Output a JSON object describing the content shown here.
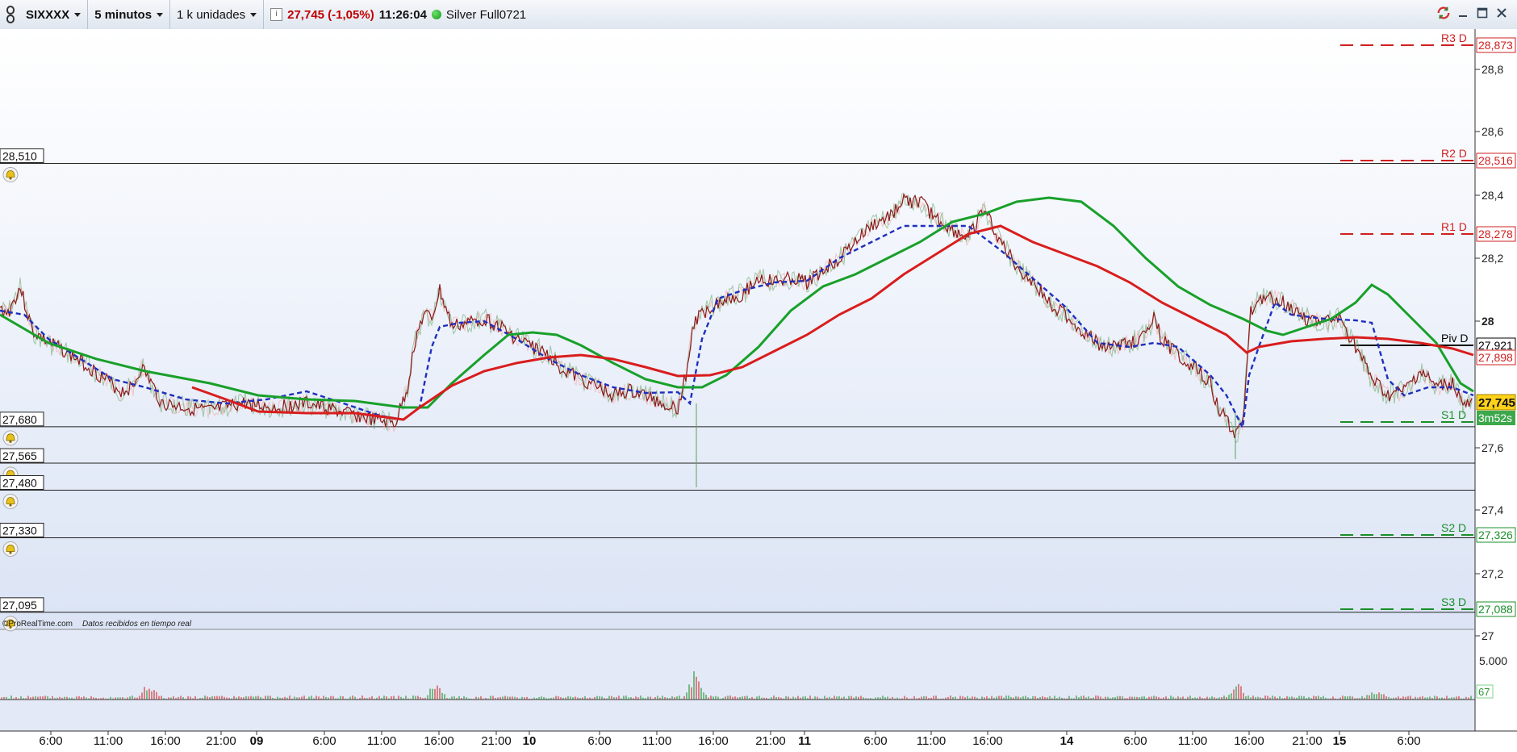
{
  "toolbar": {
    "instrument": "SIXXXX",
    "timeframe": "5 minutos",
    "units": "1 k unidades",
    "last_price": "27,745 (-1,05%)",
    "clock": "11:26:04",
    "account": "Silver Full0721"
  },
  "footer": {
    "brand": "©ProRealTime.com",
    "note": "Datos recibidos en tiempo real"
  },
  "price_axis": {
    "ticks": [
      "28,8",
      "28,6",
      "28,4",
      "28,2",
      "28",
      "27,6",
      "27,4",
      "27,2",
      "27"
    ],
    "current_price": "27,745",
    "countdown": "3m52s"
  },
  "pivots": [
    {
      "name": "R3 D",
      "value": "28,873",
      "color": "#d02020"
    },
    {
      "name": "R2 D",
      "value": "28,516",
      "color": "#d02020"
    },
    {
      "name": "R1 D",
      "value": "28,278",
      "color": "#d02020"
    },
    {
      "name": "Piv D",
      "value": "27,921",
      "color": "#000000"
    },
    {
      "name": "S1 D",
      "value": "",
      "color": "#1a8f2a"
    },
    {
      "name": "S2 D",
      "value": "27,326",
      "color": "#1a8f2a"
    },
    {
      "name": "S3 D",
      "value": "27,088",
      "color": "#1a8f2a"
    }
  ],
  "overlay_labels": [
    "27,898"
  ],
  "alert_levels": [
    "28,510",
    "27,680",
    "27,565",
    "27,480",
    "27,330",
    "27,095"
  ],
  "volume_axis": {
    "tick": "5.000",
    "current": "67"
  },
  "time_axis": [
    "6:00",
    "11:00",
    "16:00",
    "21:00",
    "09",
    "6:00",
    "11:00",
    "16:00",
    "21:00",
    "10",
    "6:00",
    "11:00",
    "16:00",
    "21:00",
    "11",
    "6:00",
    "11:00",
    "16:00",
    "14",
    "6:00",
    "11:00",
    "16:00",
    "21:00",
    "15",
    "6:00"
  ],
  "colors": {
    "price_line": "#8b1a1a",
    "ma_slow": "#d91d1d",
    "ma_fast": "#18a02a",
    "ma_dotted": "#1f2fbf",
    "price_tag": "#ffd21a",
    "countdown_tag": "#3da84b"
  }
}
